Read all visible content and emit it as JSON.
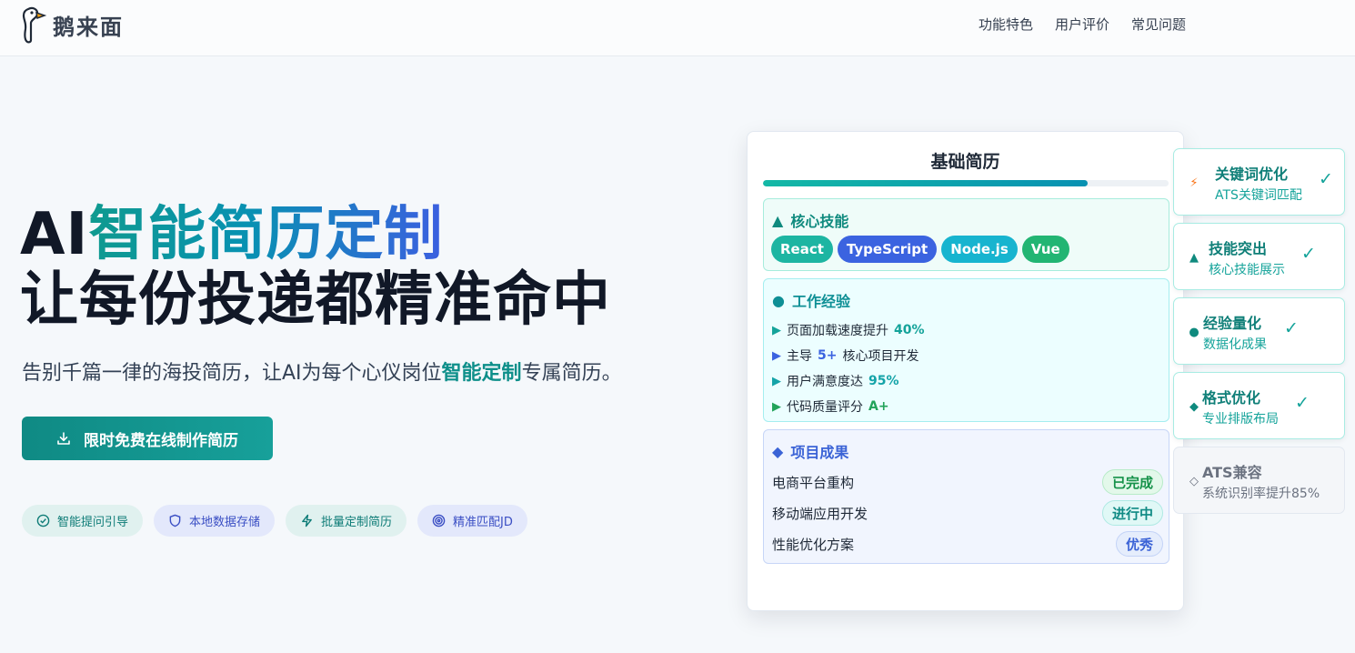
{
  "header": {
    "logo_text": "鹅来面",
    "nav": [
      "功能特色",
      "用户评价",
      "常见问题"
    ]
  },
  "hero": {
    "title_prefix": "AI",
    "title_gradient": "智能简历定制",
    "title_line2": "让每份投递都精准命中",
    "subtitle_pre": "告别千篇一律的海投简历，让AI为每个心仪岗位",
    "subtitle_highlight": "智能定制",
    "subtitle_post": "专属简历。",
    "cta_label": "限时免费在线制作简历",
    "pills": [
      "智能提问引导",
      "本地数据存储",
      "批量定制简历",
      "精准匹配JD"
    ]
  },
  "resume": {
    "title": "基础简历",
    "progress": 0.8,
    "skills": {
      "icon": "▲",
      "heading": "核心技能",
      "tags": [
        {
          "label": "React",
          "color": "#1db5a2"
        },
        {
          "label": "TypeScript",
          "color": "#3b63e0"
        },
        {
          "label": "Node.js",
          "color": "#17b4cf"
        },
        {
          "label": "Vue",
          "color": "#22b573"
        }
      ]
    },
    "work": {
      "icon": "●",
      "heading": "工作经验",
      "items": [
        {
          "arrow": "▶",
          "pre": "页面加载速度提升",
          "num": "40%",
          "post": "",
          "color": "#14a39a"
        },
        {
          "arrow": "▶",
          "pre": "主导",
          "num": "5+",
          "post": "核心项目开发",
          "color": "#3b63e0"
        },
        {
          "arrow": "▶",
          "pre": "用户满意度达",
          "num": "95%",
          "post": "",
          "color": "#14a3a8"
        },
        {
          "arrow": "▶",
          "pre": "代码质量评分",
          "num": "A+",
          "post": "",
          "color": "#22a35a"
        }
      ]
    },
    "projects": {
      "icon": "◆",
      "heading": "项目成果",
      "items": [
        {
          "name": "电商平台重构",
          "status": "已完成",
          "kind": "done"
        },
        {
          "name": "移动端应用开发",
          "status": "进行中",
          "kind": "doing"
        },
        {
          "name": "性能优化方案",
          "status": "优秀",
          "kind": "good"
        }
      ]
    }
  },
  "features": [
    {
      "icon": "⚡",
      "title": "关键词优化",
      "desc": "ATS关键词匹配",
      "check": "✓",
      "active": true
    },
    {
      "icon": "▲",
      "title": "技能突出",
      "desc": "核心技能展示",
      "check": "✓",
      "active": true
    },
    {
      "icon": "●",
      "title": "经验量化",
      "desc": "数据化成果",
      "check": "✓",
      "active": true
    },
    {
      "icon": "◆",
      "title": "格式优化",
      "desc": "专业排版布局",
      "check": "✓",
      "active": true
    },
    {
      "icon": "◇",
      "title": "ATS兼容",
      "desc": "系统识别率提升85%",
      "check": "",
      "active": false
    }
  ]
}
